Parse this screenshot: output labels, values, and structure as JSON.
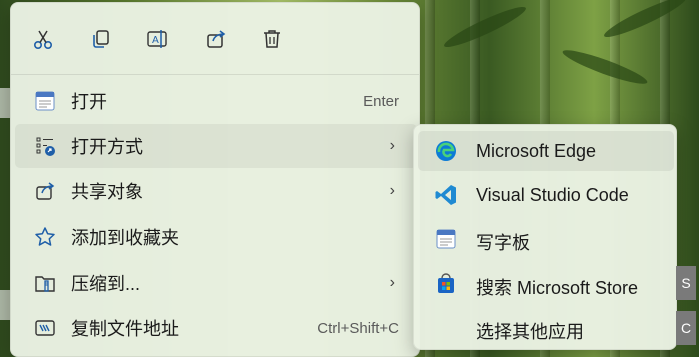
{
  "toolbar": {
    "icons": [
      "cut-icon",
      "copy-icon",
      "rename-icon",
      "share-icon",
      "delete-icon"
    ]
  },
  "menu": {
    "items": [
      {
        "label": "打开",
        "shortcut": "Enter",
        "icon": "wordpad-icon"
      },
      {
        "label": "打开方式",
        "shortcut": "",
        "icon": "open-with-icon",
        "submenu": true
      },
      {
        "label": "共享对象",
        "shortcut": "",
        "icon": "share-icon",
        "submenu": true
      },
      {
        "label": "添加到收藏夹",
        "shortcut": "",
        "icon": "star-icon"
      },
      {
        "label": "压缩到...",
        "shortcut": "",
        "icon": "zip-folder-icon",
        "submenu": true
      },
      {
        "label": "复制文件地址",
        "shortcut": "Ctrl+Shift+C",
        "icon": "copy-path-icon"
      }
    ],
    "chevron": "›"
  },
  "submenu": {
    "items": [
      {
        "label": "Microsoft Edge",
        "icon": "edge-icon"
      },
      {
        "label": "Visual Studio Code",
        "icon": "vscode-icon"
      },
      {
        "label": "写字板",
        "icon": "wordpad-icon"
      },
      {
        "label": "搜索 Microsoft Store",
        "icon": "store-icon"
      },
      {
        "label": "选择其他应用",
        "icon": ""
      }
    ]
  },
  "edge_tabs": [
    "S",
    "C"
  ],
  "colors": {
    "menu_bg": "#eaf2e3",
    "icon_blue": "#1f5fa8",
    "edge_blue": "#0c7bd6",
    "vscode_blue": "#1f8ad2"
  }
}
